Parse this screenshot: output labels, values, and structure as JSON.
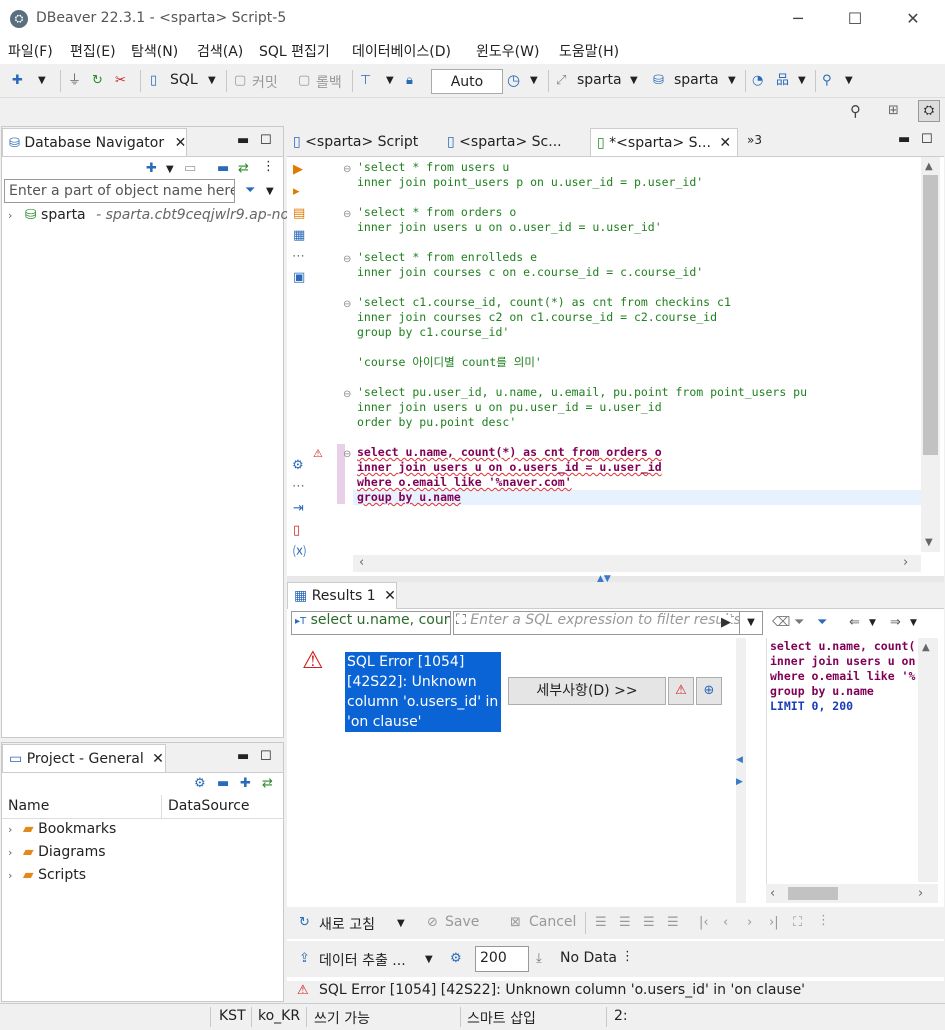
{
  "window": {
    "title": "DBeaver 22.3.1 - <sparta> Script-5"
  },
  "menu": [
    "파일(F)",
    "편집(E)",
    "탐색(N)",
    "검색(A)",
    "SQL 편집기",
    "데이터베이스(D)",
    "윈도우(W)",
    "도움말(H)"
  ],
  "toolbar": {
    "sql_label": "SQL",
    "commit_label": "커밋",
    "rollback_label": "롤백",
    "mode_value": "Auto",
    "datasource1": "sparta",
    "datasource2": "sparta"
  },
  "navigator": {
    "tab_title": "Database Navigator",
    "filter_placeholder": "Enter a part of object name here",
    "tree": [
      {
        "label": "sparta",
        "detail": "- sparta.cbt9ceqjwlr9.ap-no"
      }
    ]
  },
  "project": {
    "tab_title": "Project - General",
    "columns": [
      "Name",
      "DataSource"
    ],
    "items": [
      "Bookmarks",
      "Diagrams",
      "Scripts"
    ]
  },
  "editor_tabs": [
    "<sparta> Script",
    "<sparta> Sc...",
    "*<sparta> S...",
    "»3"
  ],
  "code_lines": {
    "l1": "'select * from users u",
    "l2": "inner join point_users p on u.user_id = p.user_id'",
    "l3": "'select * from orders o",
    "l4": "inner join users u on o.user_id = u.user_id'",
    "l5": "'select * from enrolleds e",
    "l6": "inner join courses c on e.course_id = c.course_id'",
    "l7": "'select c1.course_id, count(*) as cnt from checkins c1",
    "l8": "inner join courses c2 on c1.course_id = c2.course_id",
    "l9": "group by c1.course_id'",
    "l10": "'course 아이디별 count를 의미'",
    "l11": "'select pu.user_id, u.name, u.email, pu.point from point_users pu",
    "l12": "inner join users u on pu.user_id = u.user_id",
    "l13": "order by pu.point desc'",
    "l14": "select u.name, count(*) as cnt from orders o",
    "l15": "inner join users u on o.users_id = u.user_id",
    "l16": "where o.email like '%naver.com'",
    "l17": "group by u.name"
  },
  "results": {
    "tab_title": "Results 1",
    "query_label": "select u.name, coun",
    "filter_placeholder": "Enter a SQL expression to filter results",
    "error_text": "SQL Error [1054] [42S22]: Unknown column 'o.users_id' in 'on clause'",
    "details_button": "세부사항(D) >>",
    "side_sql": [
      "select u.name, count(",
      "inner join users u on",
      "where o.email like '%",
      "group by u.name",
      "LIMIT 0, 200"
    ],
    "refresh_label": "새로 고침",
    "save_label": "Save",
    "cancel_label": "Cancel",
    "export_label": "데이터 추출 ...",
    "fetch_size": "200",
    "no_data": "No Data",
    "status_error": "SQL Error [1054] [42S22]: Unknown column 'o.users_id' in 'on clause'"
  },
  "statusbar": {
    "tz": "KST",
    "locale": "ko_KR",
    "write": "쓰기 가능",
    "insert": "스마트 삽입",
    "pos": "2:"
  }
}
